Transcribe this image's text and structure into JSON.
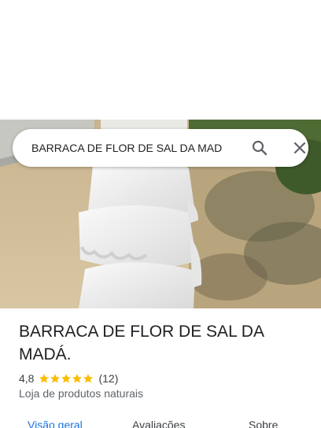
{
  "search": {
    "query": "BARRACA DE FLOR DE SAL DA MAD"
  },
  "place": {
    "name": "BARRACA DE FLOR DE SAL DA MADÁ.",
    "rating": "4,8",
    "rating_stars": 5,
    "review_count": "(12)",
    "category": "Loja de produtos naturais"
  },
  "tabs": [
    {
      "label": "Visão geral",
      "active": true
    },
    {
      "label": "Avaliações",
      "active": false
    },
    {
      "label": "Sobre",
      "active": false
    }
  ],
  "colors": {
    "accent": "#1a73e8",
    "star": "#fbbc04",
    "text_primary": "#202124",
    "text_secondary": "#5f6368"
  },
  "icons": {
    "search": "search-icon",
    "close": "close-icon",
    "star": "star-icon"
  }
}
